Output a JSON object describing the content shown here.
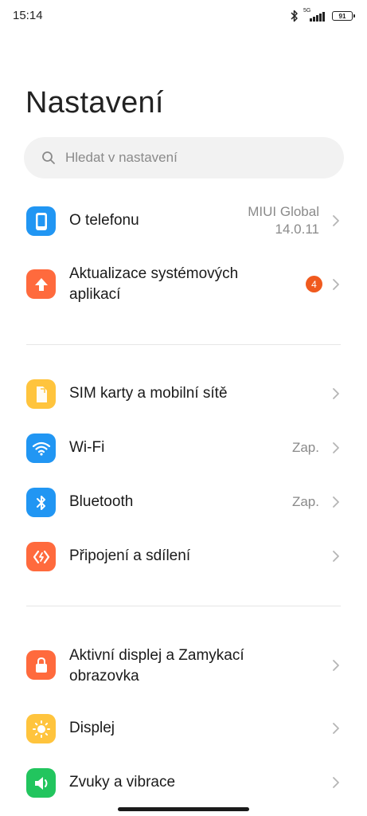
{
  "status_bar": {
    "time": "15:14",
    "network": "5G",
    "battery": "91"
  },
  "page": {
    "title": "Nastavení"
  },
  "search": {
    "placeholder": "Hledat v nastavení"
  },
  "sections": {
    "device": {
      "about": {
        "label": "O telefonu",
        "value_line1": "MIUI Global",
        "value_line2": "14.0.11",
        "icon": "phone-icon",
        "color": "#2196f3"
      },
      "updates": {
        "label_line1": "Aktualizace systémových",
        "label_line2": "aplikací",
        "badge": "4",
        "icon": "arrow-up-icon",
        "color": "#ff6a3d"
      }
    },
    "connectivity": {
      "sim": {
        "label": "SIM karty a mobilní sítě",
        "icon": "sim-card-icon",
        "color": "#ffc43d"
      },
      "wifi": {
        "label": "Wi-Fi",
        "value": "Zap.",
        "icon": "wifi-icon",
        "color": "#2196f3"
      },
      "bluetooth": {
        "label": "Bluetooth",
        "value": "Zap.",
        "icon": "bluetooth-icon",
        "color": "#2196f3"
      },
      "sharing": {
        "label": "Připojení a sdílení",
        "icon": "connection-sharing-icon",
        "color": "#ff6a3d"
      }
    },
    "display": {
      "lockscreen": {
        "label_line1": "Aktivní displej a Zamykací",
        "label_line2": "obrazovka",
        "icon": "lock-icon",
        "color": "#ff6a3d"
      },
      "display": {
        "label": "Displej",
        "icon": "sun-icon",
        "color": "#ffc43d"
      },
      "sound": {
        "label": "Zvuky a vibrace",
        "icon": "speaker-icon",
        "color": "#22c55e"
      }
    }
  }
}
